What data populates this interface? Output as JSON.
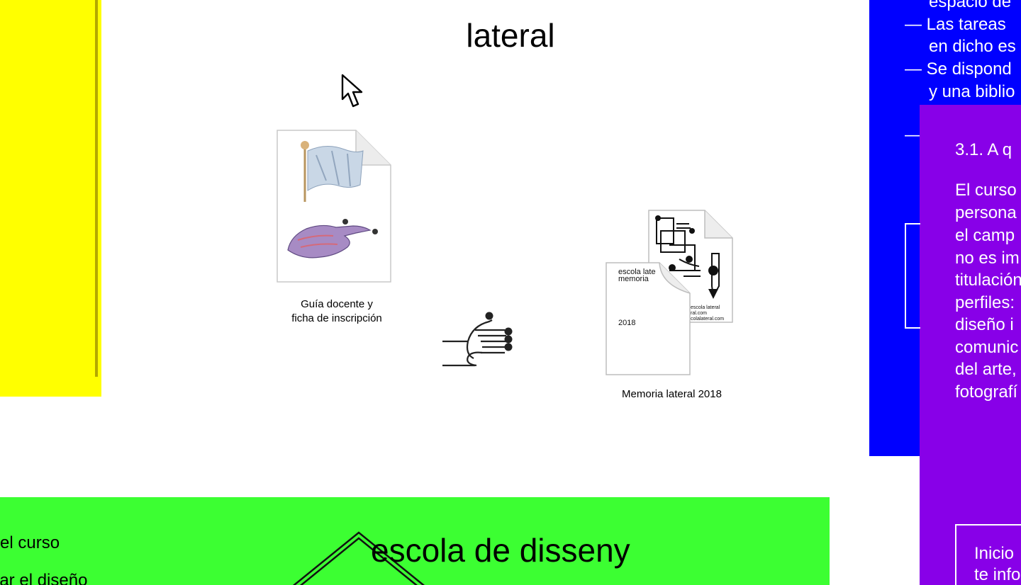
{
  "page": {
    "title": "lateral"
  },
  "desktop_icons": [
    {
      "label_line1": "Guía docente y",
      "label_line2": "ficha de inscripción",
      "icon": "document-icon"
    },
    {
      "label": "Memoria lateral 2018",
      "icon": "document-stack-icon"
    }
  ],
  "memoria_preview": {
    "header_line1": "escola late",
    "header_line2": "memoria",
    "year": "2018",
    "back_line1": "escola lateral",
    "back_line2": "ral.com",
    "back_line3": "colalateral.com"
  },
  "blue_window": {
    "lines": [
      "espacio de",
      "— Las tareas",
      "en dicho es",
      "— Se dispond",
      "y una biblio",
      "—"
    ]
  },
  "purple_window": {
    "heading": "3.1. A q",
    "body_lines": [
      "El curso",
      "persona",
      "el camp",
      "no es im",
      "titulación",
      "perfiles:",
      "diseño i",
      "comunic",
      "del arte,",
      "fotografí"
    ],
    "box_lines": [
      "Inicio",
      "te info"
    ]
  },
  "green_window": {
    "title": "escola de disseny",
    "lines": [
      "el curso",
      "lar el diseño"
    ]
  },
  "colors": {
    "yellow": "#ffff00",
    "blue": "#0000ff",
    "purple": "#8800e8",
    "green": "#3cff32"
  }
}
